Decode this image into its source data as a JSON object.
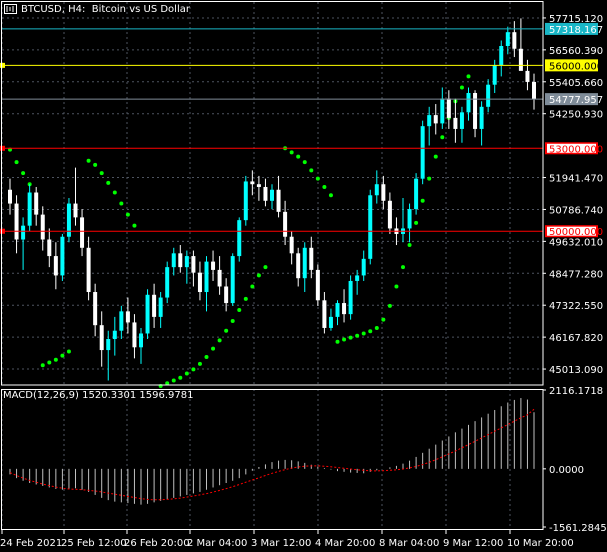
{
  "header": {
    "symbol": "BTCUSD",
    "timeframe": "H4",
    "description": "Bitcoin vs US Dollar"
  },
  "price_axis": {
    "ticks": [
      "57715.120",
      "56560.390",
      "55405.660",
      "54250.930",
      "51941.470",
      "50786.740",
      "49632.010",
      "48477.280",
      "47322.550",
      "46167.820",
      "45013.090"
    ]
  },
  "levels": [
    {
      "label": "57318.167",
      "kind": "current",
      "color": "#19b6c6"
    },
    {
      "label": "56000.000",
      "kind": "horizontal",
      "color": "#ffff00"
    },
    {
      "label": "54777.957",
      "kind": "bid",
      "color": "#7f8c99"
    },
    {
      "label": "53000.000",
      "kind": "horizontal",
      "color": "#ff0000"
    },
    {
      "label": "50000.000",
      "kind": "horizontal",
      "color": "#ff0000"
    }
  ],
  "macd": {
    "label": "MACD(12,26,9)",
    "main": "1520.3301",
    "signal": "1596.9781",
    "axis_ticks": [
      "2116.1718",
      "0.0000",
      "-1561.2845"
    ],
    "colors": {
      "histogram": "#c0c0c0",
      "signal_line": "#ff0000"
    }
  },
  "time_axis": [
    "24 Feb 2021",
    "25 Feb 12:00",
    "26 Feb 20:00",
    "2 Mar 04:00",
    "3 Mar 12:00",
    "4 Mar 20:00",
    "8 Mar 04:00",
    "9 Mar 12:00",
    "10 Mar 20:00"
  ],
  "colors": {
    "bull": "#00ffff",
    "bear": "#ffffff",
    "parabolic_sar": "#00ff00",
    "grid": "#4e5460",
    "axis_bg": "#000000"
  },
  "chart_data": {
    "type": "candlestick",
    "symbol": "BTCUSD",
    "timeframe": "H4",
    "indicators": [
      "Parabolic SAR",
      "MACD(12,26,9)"
    ],
    "ohlc": [
      [
        51500,
        51900,
        50600,
        51000
      ],
      [
        51000,
        51300,
        49200,
        49700
      ],
      [
        49700,
        50500,
        48600,
        50200
      ],
      [
        50200,
        51700,
        50000,
        51400
      ],
      [
        51400,
        51600,
        50200,
        50600
      ],
      [
        50600,
        50900,
        49300,
        49700
      ],
      [
        49700,
        50100,
        48700,
        49100
      ],
      [
        49100,
        49600,
        47900,
        48400
      ],
      [
        48400,
        49900,
        48200,
        49800
      ],
      [
        49800,
        51200,
        49600,
        51000
      ],
      [
        51000,
        52300,
        50200,
        50500
      ],
      [
        50500,
        50800,
        49100,
        49400
      ],
      [
        49400,
        49800,
        47500,
        47800
      ],
      [
        47800,
        48100,
        46200,
        46600
      ],
      [
        46600,
        47100,
        45100,
        45700
      ],
      [
        45700,
        46400,
        44600,
        46100
      ],
      [
        46100,
        46900,
        45500,
        46400
      ],
      [
        46400,
        47300,
        46100,
        47100
      ],
      [
        47100,
        47600,
        46300,
        46700
      ],
      [
        46700,
        47000,
        45400,
        45800
      ],
      [
        45800,
        46500,
        45200,
        46300
      ],
      [
        46300,
        47900,
        46100,
        47700
      ],
      [
        47700,
        48100,
        46500,
        46900
      ],
      [
        46900,
        47800,
        46500,
        47600
      ],
      [
        47600,
        48900,
        47400,
        48700
      ],
      [
        48700,
        49400,
        48400,
        49200
      ],
      [
        49200,
        49500,
        48500,
        48700
      ],
      [
        48700,
        49300,
        48100,
        49100
      ],
      [
        49100,
        49300,
        48000,
        48500
      ],
      [
        48500,
        48900,
        47500,
        47800
      ],
      [
        47800,
        49100,
        47100,
        48900
      ],
      [
        48900,
        49300,
        48200,
        48600
      ],
      [
        48600,
        49100,
        47700,
        48000
      ],
      [
        48000,
        48300,
        47100,
        47400
      ],
      [
        47400,
        49200,
        47300,
        49100
      ],
      [
        49100,
        50500,
        48900,
        50400
      ],
      [
        50400,
        52000,
        50200,
        51800
      ],
      [
        51800,
        52200,
        51300,
        51700
      ],
      [
        51700,
        52000,
        51100,
        51600
      ],
      [
        51600,
        51900,
        50900,
        51100
      ],
      [
        51100,
        51700,
        50800,
        51500
      ],
      [
        51500,
        52000,
        50500,
        50700
      ],
      [
        50700,
        51100,
        49500,
        49800
      ],
      [
        49800,
        50000,
        48800,
        49200
      ],
      [
        49200,
        49400,
        48000,
        48300
      ],
      [
        48300,
        49600,
        47800,
        49400
      ],
      [
        49400,
        49800,
        48300,
        48600
      ],
      [
        48600,
        48800,
        47300,
        47500
      ],
      [
        47500,
        47800,
        46300,
        46500
      ],
      [
        46500,
        47200,
        46400,
        46900
      ],
      [
        46900,
        47500,
        46600,
        47400
      ],
      [
        47400,
        47900,
        46700,
        47000
      ],
      [
        47000,
        48400,
        46800,
        48200
      ],
      [
        48200,
        48600,
        47700,
        48400
      ],
      [
        48400,
        49300,
        48200,
        49000
      ],
      [
        49000,
        51500,
        48800,
        51300
      ],
      [
        51300,
        52200,
        51000,
        51700
      ],
      [
        51700,
        52000,
        50800,
        51100
      ],
      [
        51100,
        51400,
        49900,
        50100
      ],
      [
        50100,
        50500,
        49500,
        49900
      ],
      [
        49900,
        51200,
        49600,
        50100
      ],
      [
        50100,
        51000,
        49600,
        50800
      ],
      [
        50800,
        52100,
        50600,
        51900
      ],
      [
        51900,
        54000,
        51700,
        53800
      ],
      [
        53800,
        54500,
        53100,
        54200
      ],
      [
        54200,
        54600,
        53500,
        53900
      ],
      [
        53900,
        55200,
        53700,
        54800
      ],
      [
        54800,
        55100,
        53700,
        54100
      ],
      [
        54100,
        54800,
        53200,
        53700
      ],
      [
        53700,
        54500,
        53200,
        54300
      ],
      [
        54300,
        55200,
        54000,
        55000
      ],
      [
        55000,
        55100,
        53400,
        53700
      ],
      [
        53700,
        54700,
        53100,
        54500
      ],
      [
        54500,
        55500,
        54300,
        55300
      ],
      [
        55300,
        56200,
        55000,
        56000
      ],
      [
        56000,
        56900,
        55600,
        56700
      ],
      [
        56700,
        57400,
        56400,
        57200
      ],
      [
        57200,
        57600,
        56300,
        56600
      ],
      [
        56600,
        57700,
        55900,
        55800
      ],
      [
        55800,
        56200,
        55100,
        55400
      ],
      [
        55400,
        55700,
        54400,
        54778
      ]
    ],
    "sar": [
      {
        "i": 0,
        "y": 52950
      },
      {
        "i": 1,
        "y": 52500
      },
      {
        "i": 2,
        "y": 52100
      },
      {
        "i": 3,
        "y": 51700
      },
      {
        "i": 5,
        "y": 45150
      },
      {
        "i": 6,
        "y": 45250
      },
      {
        "i": 7,
        "y": 45350
      },
      {
        "i": 8,
        "y": 45500
      },
      {
        "i": 9,
        "y": 45650
      },
      {
        "i": 12,
        "y": 52550
      },
      {
        "i": 13,
        "y": 52400
      },
      {
        "i": 14,
        "y": 52100
      },
      {
        "i": 15,
        "y": 51750
      },
      {
        "i": 16,
        "y": 51400
      },
      {
        "i": 17,
        "y": 51000
      },
      {
        "i": 18,
        "y": 50600
      },
      {
        "i": 19,
        "y": 50200
      },
      {
        "i": 23,
        "y": 44400
      },
      {
        "i": 24,
        "y": 44500
      },
      {
        "i": 25,
        "y": 44600
      },
      {
        "i": 26,
        "y": 44700
      },
      {
        "i": 27,
        "y": 44850
      },
      {
        "i": 28,
        "y": 45000
      },
      {
        "i": 29,
        "y": 45200
      },
      {
        "i": 30,
        "y": 45450
      },
      {
        "i": 31,
        "y": 45750
      },
      {
        "i": 32,
        "y": 46050
      },
      {
        "i": 33,
        "y": 46400
      },
      {
        "i": 34,
        "y": 46750
      },
      {
        "i": 35,
        "y": 47150
      },
      {
        "i": 36,
        "y": 47550
      },
      {
        "i": 37,
        "y": 48000
      },
      {
        "i": 38,
        "y": 48400
      },
      {
        "i": 39,
        "y": 48700
      },
      {
        "i": 42,
        "y": 53000
      },
      {
        "i": 43,
        "y": 52850
      },
      {
        "i": 44,
        "y": 52700
      },
      {
        "i": 45,
        "y": 52500
      },
      {
        "i": 46,
        "y": 52200
      },
      {
        "i": 47,
        "y": 51900
      },
      {
        "i": 48,
        "y": 51600
      },
      {
        "i": 49,
        "y": 51300
      },
      {
        "i": 50,
        "y": 46000
      },
      {
        "i": 51,
        "y": 46080
      },
      {
        "i": 52,
        "y": 46150
      },
      {
        "i": 53,
        "y": 46220
      },
      {
        "i": 54,
        "y": 46300
      },
      {
        "i": 55,
        "y": 46380
      },
      {
        "i": 56,
        "y": 46500
      },
      {
        "i": 57,
        "y": 46800
      },
      {
        "i": 58,
        "y": 47300
      },
      {
        "i": 59,
        "y": 48000
      },
      {
        "i": 60,
        "y": 48700
      },
      {
        "i": 61,
        "y": 49500
      },
      {
        "i": 62,
        "y": 50300
      },
      {
        "i": 63,
        "y": 51100
      },
      {
        "i": 64,
        "y": 51900
      },
      {
        "i": 65,
        "y": 52700
      },
      {
        "i": 66,
        "y": 53400
      },
      {
        "i": 67,
        "y": 54100
      },
      {
        "i": 68,
        "y": 54700
      },
      {
        "i": 69,
        "y": 55200
      },
      {
        "i": 70,
        "y": 55600
      }
    ],
    "macd_hist": [
      -150,
      -250,
      -320,
      -380,
      -420,
      -460,
      -500,
      -540,
      -560,
      -540,
      -520,
      -560,
      -620,
      -700,
      -780,
      -840,
      -880,
      -900,
      -920,
      -940,
      -960,
      -940,
      -900,
      -860,
      -820,
      -780,
      -740,
      -700,
      -660,
      -620,
      -560,
      -500,
      -440,
      -380,
      -320,
      -250,
      -150,
      -50,
      50,
      120,
      180,
      220,
      240,
      230,
      200,
      160,
      110,
      60,
      20,
      -20,
      -60,
      -80,
      -100,
      -110,
      -120,
      -80,
      -40,
      0,
      40,
      80,
      140,
      220,
      320,
      430,
      540,
      650,
      760,
      870,
      980,
      1080,
      1180,
      1280,
      1380,
      1480,
      1580,
      1680,
      1780,
      1850,
      1900,
      1860,
      1520
    ],
    "macd_signal": [
      -100,
      -180,
      -250,
      -310,
      -360,
      -410,
      -450,
      -490,
      -520,
      -540,
      -550,
      -560,
      -575,
      -595,
      -620,
      -650,
      -680,
      -710,
      -740,
      -770,
      -800,
      -820,
      -830,
      -830,
      -820,
      -805,
      -785,
      -760,
      -730,
      -700,
      -665,
      -625,
      -580,
      -530,
      -480,
      -420,
      -360,
      -300,
      -240,
      -180,
      -120,
      -70,
      -20,
      20,
      50,
      70,
      80,
      80,
      70,
      55,
      35,
      15,
      -5,
      -25,
      -40,
      -50,
      -55,
      -50,
      -40,
      -25,
      -5,
      25,
      65,
      115,
      175,
      245,
      320,
      400,
      480,
      565,
      650,
      740,
      830,
      920,
      1010,
      1100,
      1190,
      1280,
      1370,
      1450,
      1597
    ],
    "ylim": [
      44436,
      58292
    ],
    "macd_ylim": [
      -1561.2845,
      2116.1718
    ]
  }
}
